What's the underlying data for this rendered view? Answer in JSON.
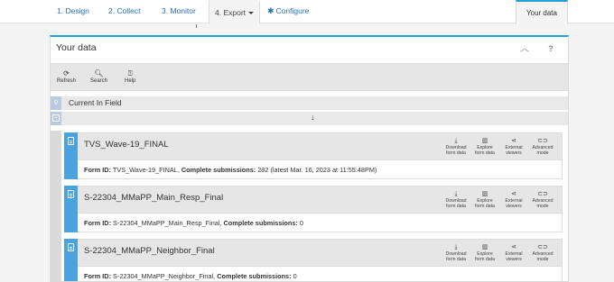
{
  "nav": {
    "tabs": [
      {
        "label": "1. Design"
      },
      {
        "label": "2. Collect"
      },
      {
        "label": "3. Monitor"
      },
      {
        "label": "4. Export"
      },
      {
        "label": "Configure"
      }
    ],
    "right_tab": "Your data"
  },
  "panel": {
    "title": "Your data",
    "toolbar": [
      {
        "label": "Refresh",
        "icon": "refresh-icon"
      },
      {
        "label": "Search",
        "icon": "search-icon"
      },
      {
        "label": "Help",
        "icon": "help-icon"
      }
    ]
  },
  "tree": {
    "group_label": "Current In Field",
    "arrow": "↓"
  },
  "actions": {
    "download": [
      "Download",
      "form data"
    ],
    "explore": [
      "Explore",
      "form data"
    ],
    "external": [
      "External",
      "viewers"
    ],
    "advanced": [
      "Advanced",
      "mode"
    ]
  },
  "forms": [
    {
      "title": "TVS_Wave-19_FINAL",
      "form_id_label": "Form ID:",
      "form_id": "TVS_Wave-19_FINAL,",
      "submissions_label": "Complete submissions:",
      "submissions": "282",
      "extra": "(latest Mar. 16, 2023 at 11:55:48PM)"
    },
    {
      "title": "S-22304_MMaPP_Main_Resp_Final",
      "form_id_label": "Form ID:",
      "form_id": "S-22304_MMaPP_Main_Resp_Final,",
      "submissions_label": "Complete submissions:",
      "submissions": "0",
      "extra": ""
    },
    {
      "title": "S-22304_MMaPP_Neighbor_Final",
      "form_id_label": "Form ID:",
      "form_id": "S-22304_MMaPP_Neighbor_Final,",
      "submissions_label": "Complete submissions:",
      "submissions": "0",
      "extra": ""
    }
  ],
  "colors": {
    "accent": "#2a9fd6",
    "link": "#2a6ebb",
    "stripe": "#4aa3df"
  }
}
